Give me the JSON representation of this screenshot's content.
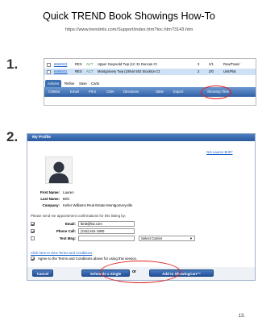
{
  "header": {
    "title": "Quick TREND Book Showings How-To",
    "url": "https://www.trendmls.com/Support/index.htm?toc.htm?3143.htm"
  },
  "steps": [
    "1.",
    "2."
  ],
  "listing_rows": [
    {
      "mls": "6684923",
      "type": "RES",
      "status": "ACT",
      "address": "Upper Gwynedd Twp (1C 31 Duncan Ct",
      "beds": "3",
      "baths": "2/1",
      "style": "Row/Town/"
    },
    {
      "mls": "6685931",
      "type": "RES",
      "status": "ACT",
      "address": "Montgomery Twp (10644 502 Stockton Ct",
      "beds": "2",
      "baths": "2/0",
      "style": "Unit/Flat"
    }
  ],
  "tabs": [
    "Actions",
    "Refine",
    "Save",
    "Carts"
  ],
  "toolbar": [
    "Criteria",
    "Email",
    "Print",
    "CMA",
    "Directions",
    "Stats",
    "Export",
    "Showing Time"
  ],
  "profile": {
    "section_title": "My Profile",
    "not_user_link": "Not Lauren Britt?",
    "first_name_label": "First Name:",
    "first_name": "Lauren",
    "last_name_label": "Last Name:",
    "last_name": "Britt",
    "company_label": "Company:",
    "company": "Keller Williams Real Estate-Montgomeryville"
  },
  "form": {
    "notice": "Please send me appointment confirmations for this listing by:",
    "email_label": "Email:",
    "email_value": "lbritt@kw.com",
    "phone_label": "Phone Call:",
    "phone_value": "(215) 631-1900",
    "text_label": "Text Msg:",
    "text_value": "",
    "carrier_placeholder": "Select Carrier",
    "terms_link": "Click here to view Terms and Conditions",
    "agree_text": "Agree to the Terms and Conditions above for using this service."
  },
  "buttons": {
    "cancel": "Cancel",
    "schedule": "Schedule a Single Showing",
    "or": "or",
    "add_cart": "Add to ShowingCart™"
  },
  "page_number": "13."
}
